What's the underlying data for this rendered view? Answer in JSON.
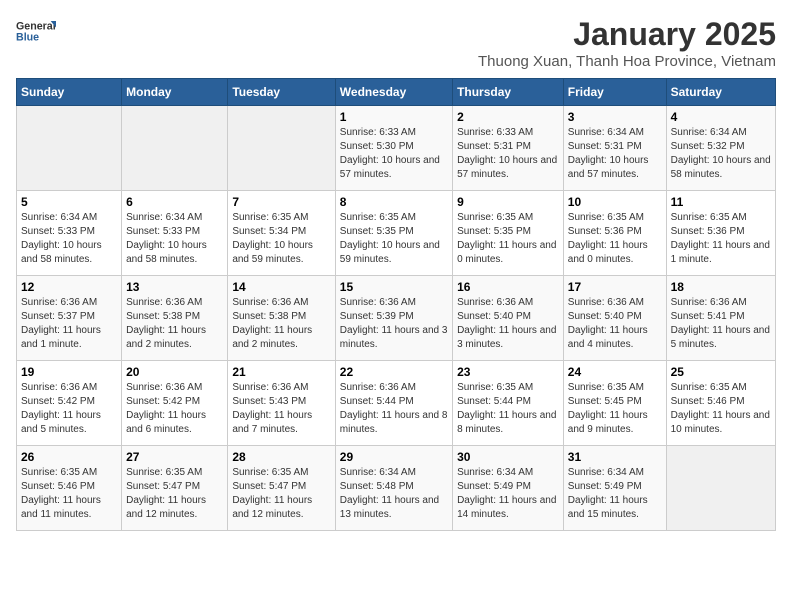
{
  "logo": {
    "general": "General",
    "blue": "Blue"
  },
  "header": {
    "title": "January 2025",
    "subtitle": "Thuong Xuan, Thanh Hoa Province, Vietnam"
  },
  "days_of_week": [
    "Sunday",
    "Monday",
    "Tuesday",
    "Wednesday",
    "Thursday",
    "Friday",
    "Saturday"
  ],
  "weeks": [
    [
      {
        "day": "",
        "info": ""
      },
      {
        "day": "",
        "info": ""
      },
      {
        "day": "",
        "info": ""
      },
      {
        "day": "1",
        "info": "Sunrise: 6:33 AM\nSunset: 5:30 PM\nDaylight: 10 hours and 57 minutes."
      },
      {
        "day": "2",
        "info": "Sunrise: 6:33 AM\nSunset: 5:31 PM\nDaylight: 10 hours and 57 minutes."
      },
      {
        "day": "3",
        "info": "Sunrise: 6:34 AM\nSunset: 5:31 PM\nDaylight: 10 hours and 57 minutes."
      },
      {
        "day": "4",
        "info": "Sunrise: 6:34 AM\nSunset: 5:32 PM\nDaylight: 10 hours and 58 minutes."
      }
    ],
    [
      {
        "day": "5",
        "info": "Sunrise: 6:34 AM\nSunset: 5:33 PM\nDaylight: 10 hours and 58 minutes."
      },
      {
        "day": "6",
        "info": "Sunrise: 6:34 AM\nSunset: 5:33 PM\nDaylight: 10 hours and 58 minutes."
      },
      {
        "day": "7",
        "info": "Sunrise: 6:35 AM\nSunset: 5:34 PM\nDaylight: 10 hours and 59 minutes."
      },
      {
        "day": "8",
        "info": "Sunrise: 6:35 AM\nSunset: 5:35 PM\nDaylight: 10 hours and 59 minutes."
      },
      {
        "day": "9",
        "info": "Sunrise: 6:35 AM\nSunset: 5:35 PM\nDaylight: 11 hours and 0 minutes."
      },
      {
        "day": "10",
        "info": "Sunrise: 6:35 AM\nSunset: 5:36 PM\nDaylight: 11 hours and 0 minutes."
      },
      {
        "day": "11",
        "info": "Sunrise: 6:35 AM\nSunset: 5:36 PM\nDaylight: 11 hours and 1 minute."
      }
    ],
    [
      {
        "day": "12",
        "info": "Sunrise: 6:36 AM\nSunset: 5:37 PM\nDaylight: 11 hours and 1 minute."
      },
      {
        "day": "13",
        "info": "Sunrise: 6:36 AM\nSunset: 5:38 PM\nDaylight: 11 hours and 2 minutes."
      },
      {
        "day": "14",
        "info": "Sunrise: 6:36 AM\nSunset: 5:38 PM\nDaylight: 11 hours and 2 minutes."
      },
      {
        "day": "15",
        "info": "Sunrise: 6:36 AM\nSunset: 5:39 PM\nDaylight: 11 hours and 3 minutes."
      },
      {
        "day": "16",
        "info": "Sunrise: 6:36 AM\nSunset: 5:40 PM\nDaylight: 11 hours and 3 minutes."
      },
      {
        "day": "17",
        "info": "Sunrise: 6:36 AM\nSunset: 5:40 PM\nDaylight: 11 hours and 4 minutes."
      },
      {
        "day": "18",
        "info": "Sunrise: 6:36 AM\nSunset: 5:41 PM\nDaylight: 11 hours and 5 minutes."
      }
    ],
    [
      {
        "day": "19",
        "info": "Sunrise: 6:36 AM\nSunset: 5:42 PM\nDaylight: 11 hours and 5 minutes."
      },
      {
        "day": "20",
        "info": "Sunrise: 6:36 AM\nSunset: 5:42 PM\nDaylight: 11 hours and 6 minutes."
      },
      {
        "day": "21",
        "info": "Sunrise: 6:36 AM\nSunset: 5:43 PM\nDaylight: 11 hours and 7 minutes."
      },
      {
        "day": "22",
        "info": "Sunrise: 6:36 AM\nSunset: 5:44 PM\nDaylight: 11 hours and 8 minutes."
      },
      {
        "day": "23",
        "info": "Sunrise: 6:35 AM\nSunset: 5:44 PM\nDaylight: 11 hours and 8 minutes."
      },
      {
        "day": "24",
        "info": "Sunrise: 6:35 AM\nSunset: 5:45 PM\nDaylight: 11 hours and 9 minutes."
      },
      {
        "day": "25",
        "info": "Sunrise: 6:35 AM\nSunset: 5:46 PM\nDaylight: 11 hours and 10 minutes."
      }
    ],
    [
      {
        "day": "26",
        "info": "Sunrise: 6:35 AM\nSunset: 5:46 PM\nDaylight: 11 hours and 11 minutes."
      },
      {
        "day": "27",
        "info": "Sunrise: 6:35 AM\nSunset: 5:47 PM\nDaylight: 11 hours and 12 minutes."
      },
      {
        "day": "28",
        "info": "Sunrise: 6:35 AM\nSunset: 5:47 PM\nDaylight: 11 hours and 12 minutes."
      },
      {
        "day": "29",
        "info": "Sunrise: 6:34 AM\nSunset: 5:48 PM\nDaylight: 11 hours and 13 minutes."
      },
      {
        "day": "30",
        "info": "Sunrise: 6:34 AM\nSunset: 5:49 PM\nDaylight: 11 hours and 14 minutes."
      },
      {
        "day": "31",
        "info": "Sunrise: 6:34 AM\nSunset: 5:49 PM\nDaylight: 11 hours and 15 minutes."
      },
      {
        "day": "",
        "info": ""
      }
    ]
  ]
}
